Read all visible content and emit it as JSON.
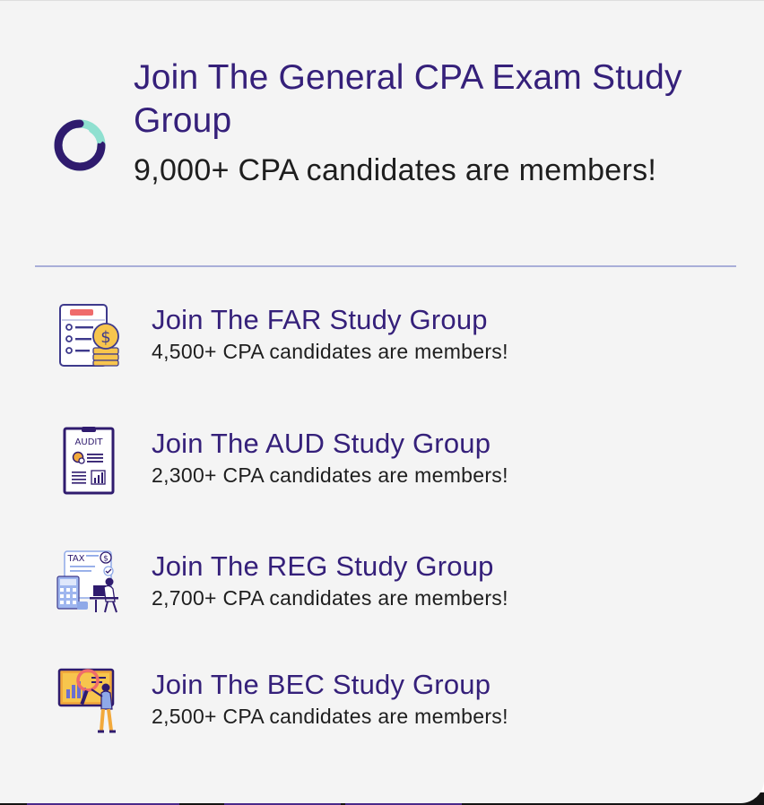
{
  "main_group": {
    "title": "Join The General CPA Exam Study Group",
    "subtitle": "9,000+ CPA candidates are members!",
    "icon": "ring-logo-icon"
  },
  "groups": [
    {
      "title": "Join The FAR Study Group",
      "subtitle": "4,500+ CPA candidates are members!",
      "icon": "financial-document-icon"
    },
    {
      "title": "Join The AUD Study Group",
      "subtitle": "2,300+ CPA candidates are members!",
      "icon": "audit-clipboard-icon",
      "icon_label": "AUDIT"
    },
    {
      "title": "Join The REG Study Group",
      "subtitle": "2,700+ CPA candidates are members!",
      "icon": "tax-desk-icon",
      "icon_label": "TAX"
    },
    {
      "title": "Join The BEC Study Group",
      "subtitle": "2,500+ CPA candidates are members!",
      "icon": "business-analysis-icon"
    }
  ],
  "colors": {
    "title": "#35207a",
    "text": "#1e1e1e",
    "card_background": "#f4f4f4",
    "divider": "#a9aed8",
    "accent_teal": "#8fe0d0",
    "accent_orange": "#f2a93b"
  }
}
